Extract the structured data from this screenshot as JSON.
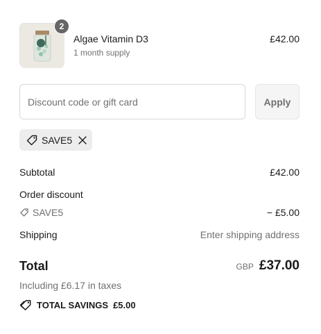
{
  "line_item": {
    "image_alt": "Algae Vitamin D3 jar",
    "quantity": "2",
    "name": "Algae Vitamin D3",
    "variant": "1 month supply",
    "price": "£42.00"
  },
  "discount": {
    "placeholder": "Discount code or gift card",
    "value": "",
    "apply_label": "Apply",
    "applied_code": "SAVE5"
  },
  "summary": {
    "subtotal_label": "Subtotal",
    "subtotal_value": "£42.00",
    "order_discount_label": "Order discount",
    "discount_code": "SAVE5",
    "discount_value": "− £5.00",
    "shipping_label": "Shipping",
    "shipping_value": "Enter shipping address",
    "total_label": "Total",
    "currency": "GBP",
    "total_value": "£37.00",
    "tax_note": "Including £6.17 in taxes",
    "savings_label": "TOTAL SAVINGS",
    "savings_value": "£5.00"
  },
  "icons": {
    "tag": "tag-icon",
    "close": "close-icon",
    "savings": "savings-tag-icon"
  }
}
